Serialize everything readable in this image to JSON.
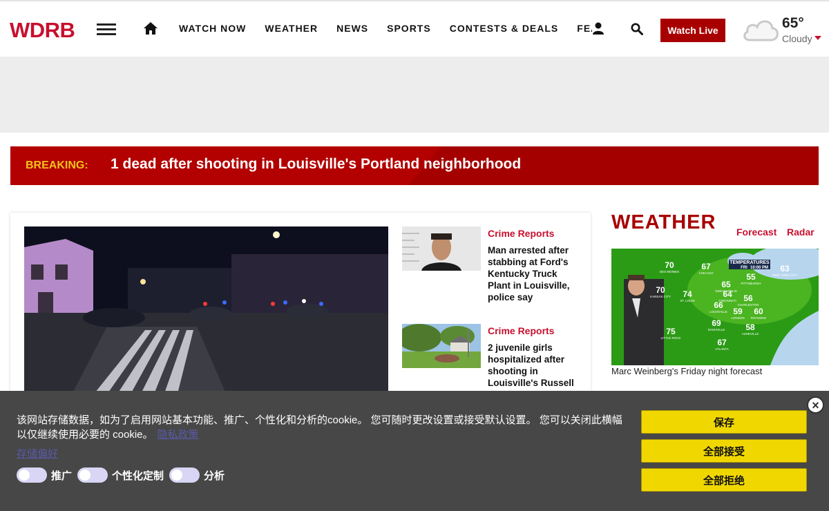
{
  "header": {
    "logo": "WDRB",
    "nav": [
      "WATCH NOW",
      "WEATHER",
      "NEWS",
      "SPORTS",
      "CONTESTS & DEALS",
      "FEATURES"
    ],
    "watch_live": "Watch Live",
    "weather": {
      "temp": "65°",
      "condition": "Cloudy"
    }
  },
  "breaking": {
    "label": "BREAKING:",
    "headline": "1 dead after shooting in Louisville's Portland neighborhood"
  },
  "stories": [
    {
      "category": "Crime Reports",
      "headline": "Man arrested after stabbing at Ford's Kentucky Truck Plant in Louisville, police say"
    },
    {
      "category": "Crime Reports",
      "headline": "2 juvenile girls hospitalized after shooting in Louisville's Russell"
    }
  ],
  "weather_section": {
    "title": "WEATHER",
    "links": [
      "Forecast",
      "Radar"
    ],
    "map_header": [
      "TEMPERATURES",
      "FRI",
      "10:00 PM"
    ],
    "map_cities": [
      {
        "name": "DES MOINES",
        "temp": "70"
      },
      {
        "name": "CHICAGO",
        "temp": "67"
      },
      {
        "name": "NEW YORK CITY",
        "temp": "63"
      },
      {
        "name": "PITTSBURGH",
        "temp": "55"
      },
      {
        "name": "INDIANAPOLIS",
        "temp": "65"
      },
      {
        "name": "KANSAS CITY",
        "temp": "70"
      },
      {
        "name": "ST. LOUIS",
        "temp": "74"
      },
      {
        "name": "CINCINNATI",
        "temp": "64"
      },
      {
        "name": "CHARLESTON",
        "temp": "56"
      },
      {
        "name": "LOUISVILLE",
        "temp": "66"
      },
      {
        "name": "LONDON",
        "temp": "59"
      },
      {
        "name": "ROANOKE",
        "temp": "60"
      },
      {
        "name": "NASHVILLE",
        "temp": "69"
      },
      {
        "name": "ASHEVILLE",
        "temp": "58"
      },
      {
        "name": "LITTLE ROCK",
        "temp": "75"
      },
      {
        "name": "ATLANTA",
        "temp": "67"
      }
    ],
    "caption": "Marc Weinberg's Friday night forecast"
  },
  "cookie": {
    "text": "该网站存储数据，如为了启用网站基本功能、推广、个性化和分析的cookie。 您可随时更改设置或接受默认设置。 您可以关闭此横幅以仅继续使用必要的 cookie。",
    "policy_link": "隐私政策",
    "prefs_link": "存储偏好",
    "toggles": [
      "推广",
      "个性化定制",
      "分析"
    ],
    "buttons": [
      "保存",
      "全部接受",
      "全部拒绝"
    ],
    "close": "×"
  }
}
